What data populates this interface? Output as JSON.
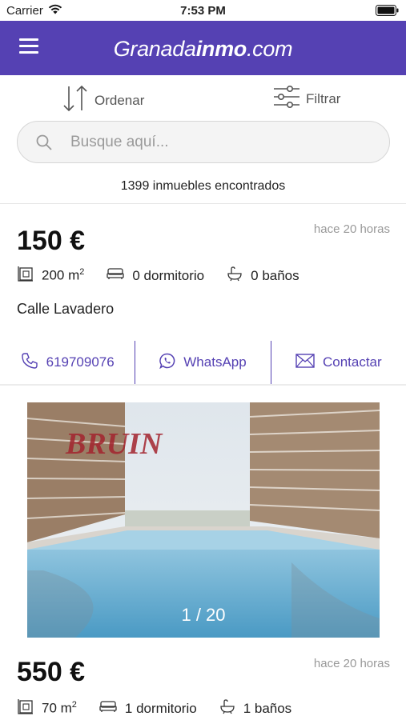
{
  "status_bar": {
    "carrier": "Carrier",
    "time": "7:53 PM"
  },
  "header": {
    "brand_regular": "Granada",
    "brand_bold": "inmo",
    "brand_suffix": ".com"
  },
  "toolbar": {
    "sort_label": "Ordenar",
    "filter_label": "Filtrar"
  },
  "search": {
    "placeholder": "Busque aquí..."
  },
  "results": {
    "count_text": "1399 inmuebles encontrados"
  },
  "listings": [
    {
      "price": "150 €",
      "time_ago": "hace 20 horas",
      "area": "200 m",
      "area_sup": "2",
      "bedrooms": "0 dormitorio",
      "bathrooms": "0 baños",
      "address": "Calle Lavadero",
      "phone": "619709076",
      "whatsapp_label": "WhatsApp",
      "contact_label": "Contactar"
    },
    {
      "price": "550 €",
      "time_ago": "hace 20 horas",
      "area": "70 m",
      "area_sup": "2",
      "bedrooms": "1 dormitorio",
      "bathrooms": "1 baños",
      "photo_counter": "1 / 20",
      "watermark": "BRUIN"
    }
  ],
  "colors": {
    "brand": "#5541b3",
    "muted": "#999999"
  }
}
